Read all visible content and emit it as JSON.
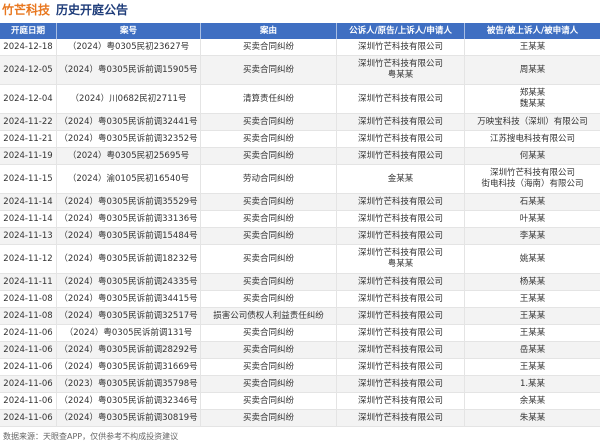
{
  "title": {
    "company": "竹芒科技",
    "text": "历史开庭公告"
  },
  "colors": {
    "company_title": "#e8771f",
    "title": "#1f3d7a",
    "header_bg": "#3f6fc2",
    "stripe_bg": "#f3f3f3"
  },
  "table": {
    "columns": [
      "开庭日期",
      "案号",
      "案由",
      "公诉人/原告/上诉人/申请人",
      "被告/被上诉人/被申请人"
    ],
    "rows": [
      {
        "date": "2024-12-18",
        "case_no": "（2024）粤0305民初23627号",
        "cause": "买卖合同纠纷",
        "plaintiffs": [
          "深圳竹芒科技有限公司"
        ],
        "defendants": [
          "王某某"
        ]
      },
      {
        "date": "2024-12-05",
        "case_no": "（2024）粤0305民诉前调15905号",
        "cause": "买卖合同纠纷",
        "plaintiffs": [
          "深圳竹芒科技有限公司",
          "粤某某"
        ],
        "defendants": [
          "周某某"
        ]
      },
      {
        "date": "2024-12-04",
        "case_no": "（2024）川0682民初2711号",
        "cause": "清算责任纠纷",
        "plaintiffs": [
          "深圳竹芒科技有限公司"
        ],
        "defendants": [
          "郑某某",
          "魏某某"
        ]
      },
      {
        "date": "2024-11-22",
        "case_no": "（2024）粤0305民诉前调32441号",
        "cause": "买卖合同纠纷",
        "plaintiffs": [
          "深圳竹芒科技有限公司"
        ],
        "defendants": [
          "万映宝科技（深圳）有限公司"
        ]
      },
      {
        "date": "2024-11-21",
        "case_no": "（2024）粤0305民诉前调32352号",
        "cause": "买卖合同纠纷",
        "plaintiffs": [
          "深圳竹芒科技有限公司"
        ],
        "defendants": [
          "江苏搜电科技有限公司"
        ]
      },
      {
        "date": "2024-11-19",
        "case_no": "（2024）粤0305民初25695号",
        "cause": "买卖合同纠纷",
        "plaintiffs": [
          "深圳竹芒科技有限公司"
        ],
        "defendants": [
          "何某某"
        ]
      },
      {
        "date": "2024-11-15",
        "case_no": "（2024）渝0105民初16540号",
        "cause": "劳动合同纠纷",
        "plaintiffs": [
          "金某某"
        ],
        "defendants": [
          "深圳竹芒科技有限公司",
          "街电科技（海南）有限公司"
        ]
      },
      {
        "date": "2024-11-14",
        "case_no": "（2024）粤0305民诉前调35529号",
        "cause": "买卖合同纠纷",
        "plaintiffs": [
          "深圳竹芒科技有限公司"
        ],
        "defendants": [
          "石某某"
        ]
      },
      {
        "date": "2024-11-14",
        "case_no": "（2024）粤0305民诉前调33136号",
        "cause": "买卖合同纠纷",
        "plaintiffs": [
          "深圳竹芒科技有限公司"
        ],
        "defendants": [
          "叶某某"
        ]
      },
      {
        "date": "2024-11-13",
        "case_no": "（2024）粤0305民诉前调15484号",
        "cause": "买卖合同纠纷",
        "plaintiffs": [
          "深圳竹芒科技有限公司"
        ],
        "defendants": [
          "李某某"
        ]
      },
      {
        "date": "2024-11-12",
        "case_no": "（2024）粤0305民诉前调18232号",
        "cause": "买卖合同纠纷",
        "plaintiffs": [
          "深圳竹芒科技有限公司",
          "粤某某"
        ],
        "defendants": [
          "姚某某"
        ]
      },
      {
        "date": "2024-11-11",
        "case_no": "（2024）粤0305民诉前调24335号",
        "cause": "买卖合同纠纷",
        "plaintiffs": [
          "深圳竹芒科技有限公司"
        ],
        "defendants": [
          "杨某某"
        ]
      },
      {
        "date": "2024-11-08",
        "case_no": "（2024）粤0305民诉前调34415号",
        "cause": "买卖合同纠纷",
        "plaintiffs": [
          "深圳竹芒科技有限公司"
        ],
        "defendants": [
          "王某某"
        ]
      },
      {
        "date": "2024-11-08",
        "case_no": "（2024）粤0305民诉前调32517号",
        "cause": "损害公司债权人利益责任纠纷",
        "plaintiffs": [
          "深圳竹芒科技有限公司"
        ],
        "defendants": [
          "王某某"
        ]
      },
      {
        "date": "2024-11-06",
        "case_no": "（2024）粤0305民诉前调131号",
        "cause": "买卖合同纠纷",
        "plaintiffs": [
          "深圳竹芒科技有限公司"
        ],
        "defendants": [
          "王某某"
        ]
      },
      {
        "date": "2024-11-06",
        "case_no": "（2024）粤0305民诉前调28292号",
        "cause": "买卖合同纠纷",
        "plaintiffs": [
          "深圳竹芒科技有限公司"
        ],
        "defendants": [
          "岳某某"
        ]
      },
      {
        "date": "2024-11-06",
        "case_no": "（2024）粤0305民诉前调31669号",
        "cause": "买卖合同纠纷",
        "plaintiffs": [
          "深圳竹芒科技有限公司"
        ],
        "defendants": [
          "王某某"
        ]
      },
      {
        "date": "2024-11-06",
        "case_no": "（2023）粤0305民诉前调35798号",
        "cause": "买卖合同纠纷",
        "plaintiffs": [
          "深圳竹芒科技有限公司"
        ],
        "defendants": [
          "1.某某"
        ]
      },
      {
        "date": "2024-11-06",
        "case_no": "（2024）粤0305民诉前调32346号",
        "cause": "买卖合同纠纷",
        "plaintiffs": [
          "深圳竹芒科技有限公司"
        ],
        "defendants": [
          "余某某"
        ]
      },
      {
        "date": "2024-11-06",
        "case_no": "（2024）粤0305民诉前调30819号",
        "cause": "买卖合同纠纷",
        "plaintiffs": [
          "深圳竹芒科技有限公司"
        ],
        "defendants": [
          "朱某某"
        ]
      }
    ]
  },
  "footer": "数据来源：天眼查APP，仅供参考不构成投资建议"
}
